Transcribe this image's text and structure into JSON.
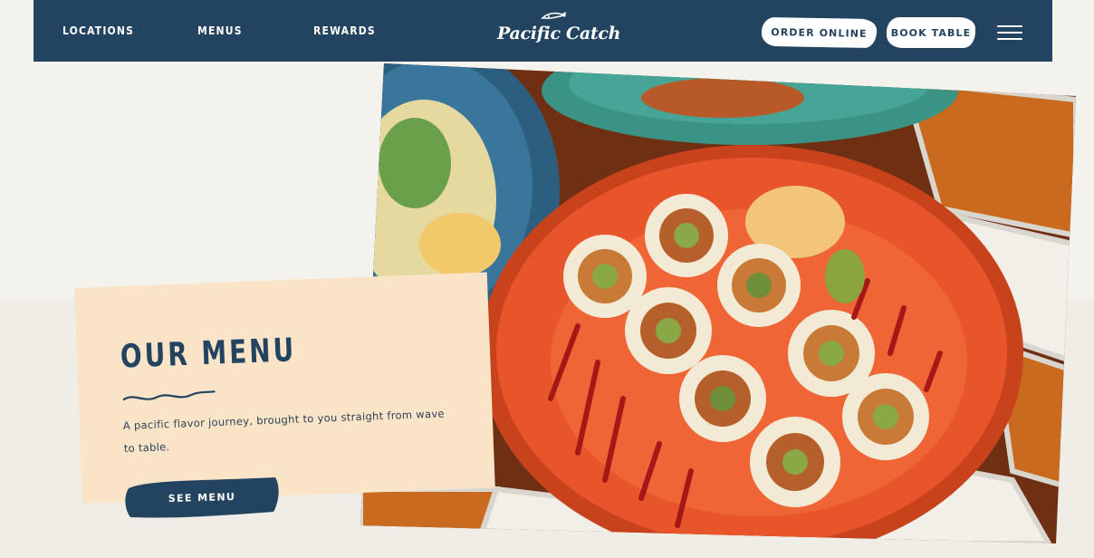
{
  "nav": {
    "links": [
      {
        "label": "LOCATIONS"
      },
      {
        "label": "MENUS"
      },
      {
        "label": "REWARDS"
      }
    ],
    "logo_text": "Pacific Catch",
    "order_online_label": "ORDER ONLINE",
    "book_table_label": "BOOK TABLE",
    "menu_icon": "hamburger-icon"
  },
  "hero": {
    "image_subject": "sushi rolls on orange plate"
  },
  "menu_card": {
    "title": "OUR MENU",
    "description": "A pacific flavor journey, brought to you straight from wave to table.",
    "button_label": "SEE MENU"
  },
  "colors": {
    "navy": "#234461",
    "card": "#fae4c8",
    "page": "#f4f2ec",
    "plate": "#e8552a"
  }
}
